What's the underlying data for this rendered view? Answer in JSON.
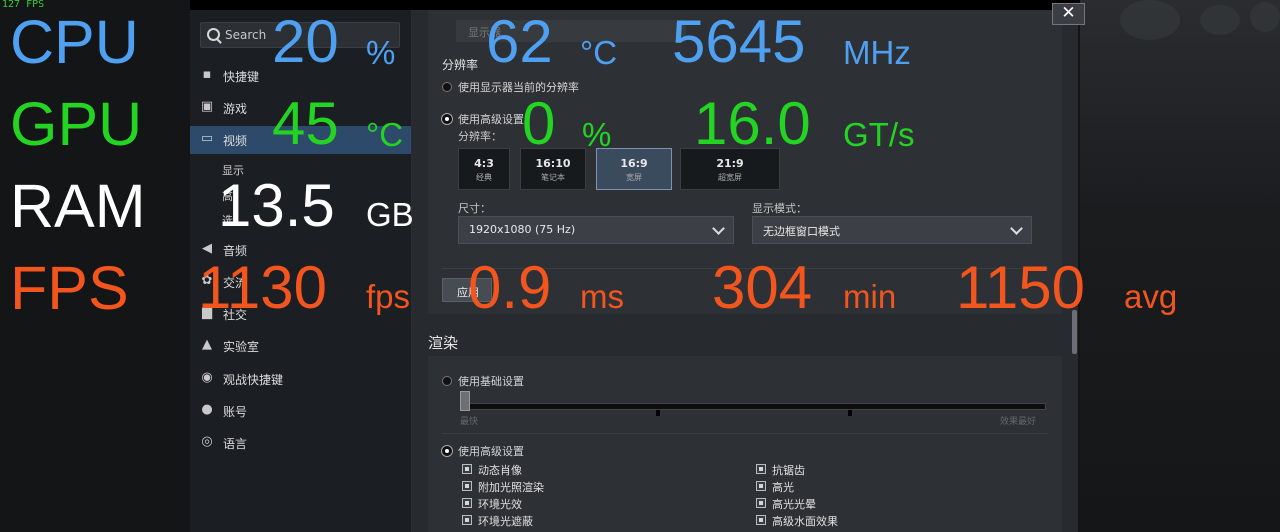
{
  "overlay_fps": "127 FPS",
  "window": {
    "close_glyph": "✕"
  },
  "sidebar": {
    "search_placeholder": "Search",
    "items": [
      {
        "label": "快捷键",
        "icon": "grid-icon"
      },
      {
        "label": "游戏",
        "icon": "game-icon"
      },
      {
        "label": "视频",
        "icon": "monitor-icon"
      },
      {
        "label": "音频",
        "icon": "speaker-icon"
      },
      {
        "label": "交流",
        "icon": "gear-icon"
      },
      {
        "label": "社交",
        "icon": "chat-icon"
      },
      {
        "label": "实验室",
        "icon": "flask-icon"
      },
      {
        "label": "观战快捷键",
        "icon": "camera-icon"
      },
      {
        "label": "账号",
        "icon": "user-icon"
      },
      {
        "label": "语言",
        "icon": "globe-icon"
      }
    ],
    "sub_items": [
      "显示",
      "高",
      "选"
    ]
  },
  "video": {
    "display_select_value": "显示器",
    "resolution_section": "分辨率",
    "use_current": "使用显示器当前的分辨率",
    "use_advanced": "使用高级设置",
    "ratio_label": "分辨率：",
    "ratios": [
      {
        "ratio": "4:3",
        "desc": "经典"
      },
      {
        "ratio": "16:10",
        "desc": "笔记本"
      },
      {
        "ratio": "16:9",
        "desc": "宽屏"
      },
      {
        "ratio": "21:9",
        "desc": "超宽屏"
      }
    ],
    "selected_ratio": "16:9",
    "size_label": "尺寸：",
    "size_value": "1920x1080 (75 Hz)",
    "display_mode_label": "显示模式：",
    "display_mode_value": "无边框窗口模式",
    "apply_label": "应用",
    "render_section": "渲染",
    "use_basic": "使用基础设置",
    "slider_min": "最快",
    "slider_max": "效果最好",
    "use_advanced_render": "使用高级设置",
    "checkboxes_left": [
      "动态肖像",
      "附加光照渲染",
      "环境光效",
      "环境光遮蔽"
    ],
    "checkboxes_right": [
      "抗锯齿",
      "高光",
      "高光光晕",
      "高级水面效果"
    ]
  },
  "overlay": {
    "cpu": {
      "label": "CPU",
      "usage": "20",
      "usage_unit": "%",
      "temp": "62",
      "temp_unit": "°C",
      "clock": "5645",
      "clock_unit": "MHz"
    },
    "gpu": {
      "label": "GPU",
      "temp": "45",
      "temp_unit": "°C",
      "usage": "0",
      "usage_unit": "%",
      "bus": "16.0",
      "bus_unit": "GT/s"
    },
    "ram": {
      "label": "RAM",
      "value": "13.5",
      "unit": "GB"
    },
    "fps": {
      "label": "FPS",
      "value": "1130",
      "unit": "fps",
      "frametime": "0.9",
      "frametime_unit": "ms",
      "min": "304",
      "min_unit": "min",
      "avg": "1150",
      "avg_unit": "avg"
    }
  }
}
